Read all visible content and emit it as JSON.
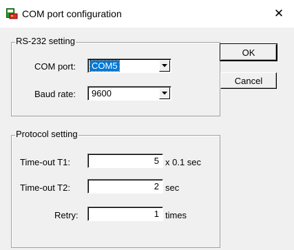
{
  "window": {
    "title": "COM port configuration",
    "icon": "app-window-icon",
    "close_icon": "close-icon"
  },
  "rs232": {
    "legend": "RS-232 setting",
    "com_port_label": "COM port:",
    "com_port_value": "COM5",
    "baud_rate_label": "Baud rate:",
    "baud_rate_value": "9600"
  },
  "protocol": {
    "legend": "Protocol setting",
    "t1_label": "Time-out T1:",
    "t1_value": "5",
    "t1_unit": "x 0.1 sec",
    "t2_label": "Time-out T2:",
    "t2_value": "2",
    "t2_unit": "sec",
    "retry_label": "Retry:",
    "retry_value": "1",
    "retry_unit": "times"
  },
  "buttons": {
    "ok": "OK",
    "cancel": "Cancel"
  },
  "colors": {
    "selection": "#0078d7",
    "dialog_bg": "#f0f0f0"
  }
}
